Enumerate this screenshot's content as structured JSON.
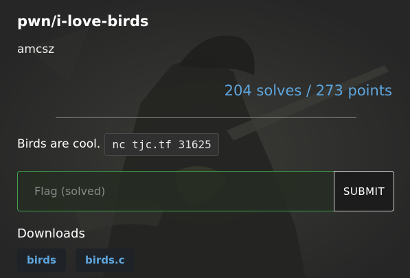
{
  "challenge": {
    "title": "pwn/i-love-birds",
    "author": "amcsz",
    "solves_text": "204 solves / 273 points",
    "description_text": "Birds are cool.",
    "command": "nc tjc.tf 31625"
  },
  "flag_form": {
    "placeholder": "Flag (solved)",
    "value": "",
    "submit_label": "SUBMIT"
  },
  "downloads": {
    "label": "Downloads",
    "files": [
      "birds",
      "birds.c"
    ]
  },
  "colors": {
    "background": "#2a2a2a",
    "accent_blue": "#5ea6de",
    "solved_green": "#3fa34d"
  }
}
